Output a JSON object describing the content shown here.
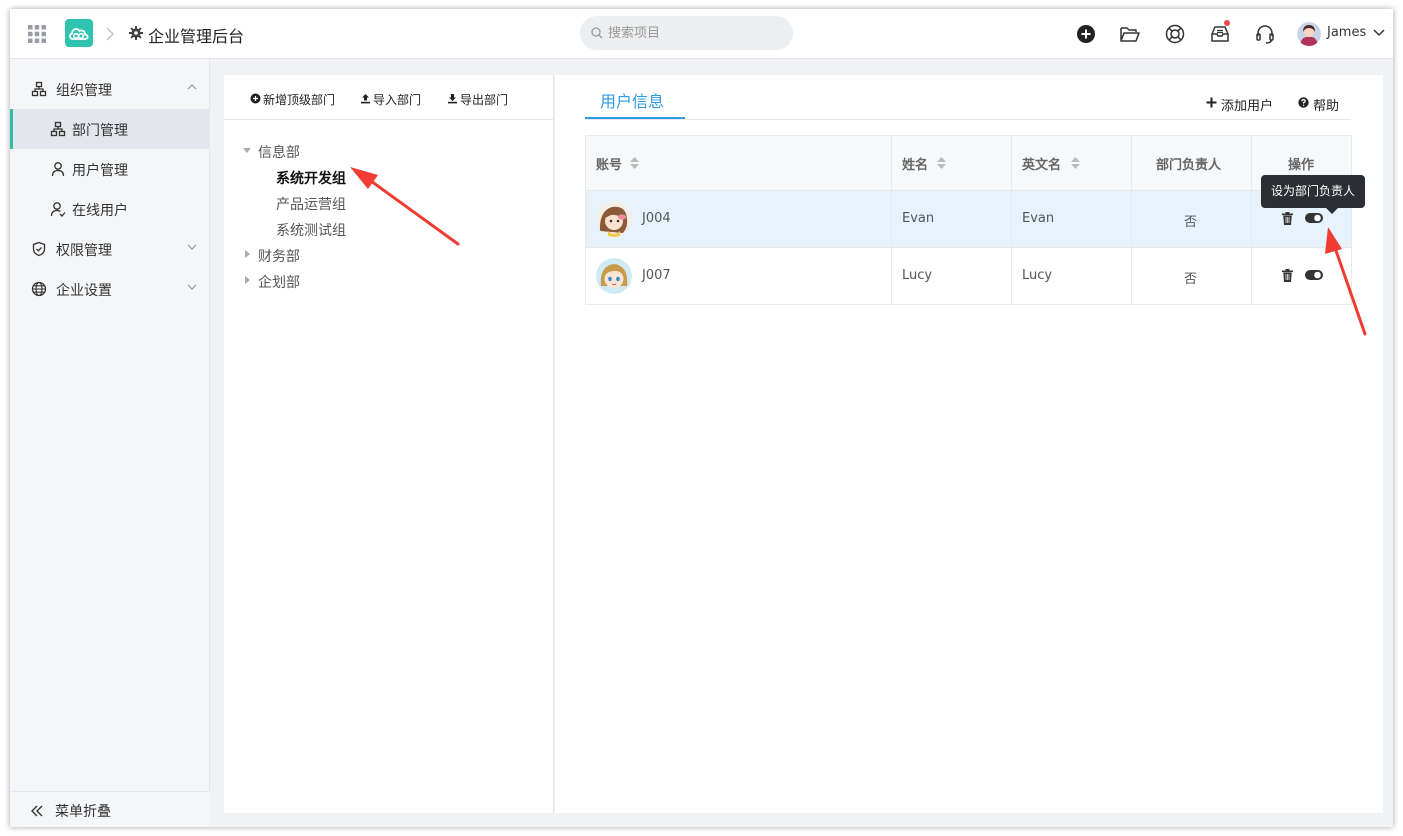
{
  "header": {
    "app_title": "企业管理后台",
    "search_placeholder": "搜索项目",
    "user_name": "James",
    "icons": [
      "apps-grid-icon",
      "cloud-logo",
      "chevron-right-icon",
      "gear-icon",
      "search-icon",
      "plus-circle-icon",
      "folder-open-icon",
      "lifebuoy-icon",
      "inbox-icon",
      "headset-icon",
      "chevron-down-icon"
    ],
    "accent_color": "#2ec4b0",
    "notification_dot_color": "#f04848"
  },
  "sidebar": {
    "items": [
      {
        "label": "组织管理",
        "icon": "org-chart-icon",
        "level": 1,
        "expanded": true
      },
      {
        "label": "部门管理",
        "icon": "org-chart-icon",
        "level": 2,
        "active": true
      },
      {
        "label": "用户管理",
        "icon": "user-icon",
        "level": 2
      },
      {
        "label": "在线用户",
        "icon": "user-online-icon",
        "level": 2
      },
      {
        "label": "权限管理",
        "icon": "shield-check-icon",
        "level": 1,
        "expanded": false
      },
      {
        "label": "企业设置",
        "icon": "globe-icon",
        "level": 1,
        "expanded": false
      }
    ],
    "collapse_label": "菜单折叠"
  },
  "dept_panel": {
    "toolbar": {
      "add_top": "新增顶级部门",
      "import": "导入部门",
      "export": "导出部门"
    },
    "tree": [
      {
        "label": "信息部",
        "expanded": true,
        "children": [
          {
            "label": "系统开发组",
            "selected": true
          },
          {
            "label": "产品运营组"
          },
          {
            "label": "系统测试组"
          }
        ]
      },
      {
        "label": "财务部",
        "expanded": false
      },
      {
        "label": "企划部",
        "expanded": false
      }
    ]
  },
  "user_panel": {
    "tab_label": "用户信息",
    "add_user": "添加用户",
    "help": "帮助",
    "table": {
      "columns": [
        "账号",
        "姓名",
        "英文名",
        "部门负责人",
        "操作"
      ],
      "rows": [
        {
          "account": "J004",
          "name": "Evan",
          "english_name": "Evan",
          "is_leader": "否"
        },
        {
          "account": "J007",
          "name": "Lucy",
          "english_name": "Lucy",
          "is_leader": "否"
        }
      ]
    },
    "tooltip": "设为部门负责人",
    "active_tab_color": "#2f9be0"
  },
  "annotations": {
    "arrow_color": "#f03c32"
  }
}
